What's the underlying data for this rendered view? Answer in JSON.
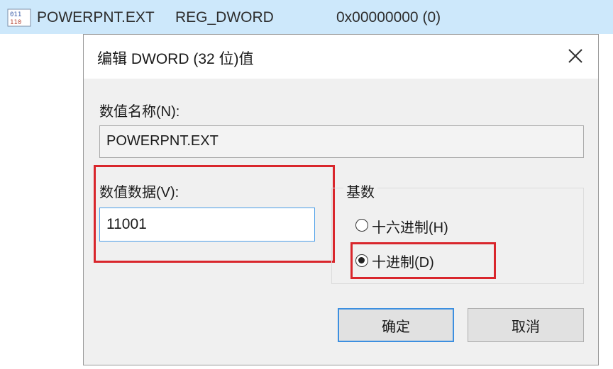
{
  "registry_row": {
    "icon": "registry-value-icon",
    "name": "POWERPNT.EXT",
    "type": "REG_DWORD",
    "data": "0x00000000 (0)"
  },
  "dialog": {
    "title": "编辑 DWORD (32 位)值",
    "close_icon": "close-icon",
    "value_name_label": "数值名称(N):",
    "value_name": "POWERPNT.EXT",
    "value_data_label": "数值数据(V):",
    "value_data": "11001",
    "base_label": "基数",
    "base_options": [
      {
        "label": "十六进制(H)",
        "selected": false
      },
      {
        "label": "十进制(D)",
        "selected": true
      }
    ],
    "ok_label": "确定",
    "cancel_label": "取消"
  },
  "colors": {
    "highlight": "#d9262c",
    "selected_row": "#cde8fb",
    "focus_border": "#3c8fe0"
  }
}
